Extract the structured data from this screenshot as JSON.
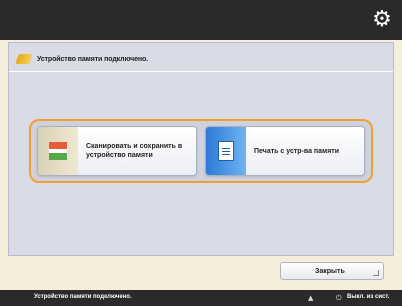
{
  "header": {
    "settings_icon": "gear-icon"
  },
  "panel": {
    "message": "Устройство памяти подключено.",
    "message_icon": "memory-stick-icon",
    "options": [
      {
        "label": "Сканировать и сохранить в устройство памяти",
        "icon": "scan-to-memory-icon"
      },
      {
        "label": "Печать с устр-ва памяти",
        "icon": "print-from-memory-icon"
      }
    ],
    "close_label": "Закрыть"
  },
  "status_bar": {
    "text": "Устройство памяти подключено.",
    "eject_icon": "eject-icon",
    "energy_icon": "energy-saver-icon",
    "energy_label": "Выкл. из сист."
  },
  "colors": {
    "accent": "#f0a030",
    "title_bar": "#2a2a2a",
    "panel_bg": "#d9dbe6"
  }
}
